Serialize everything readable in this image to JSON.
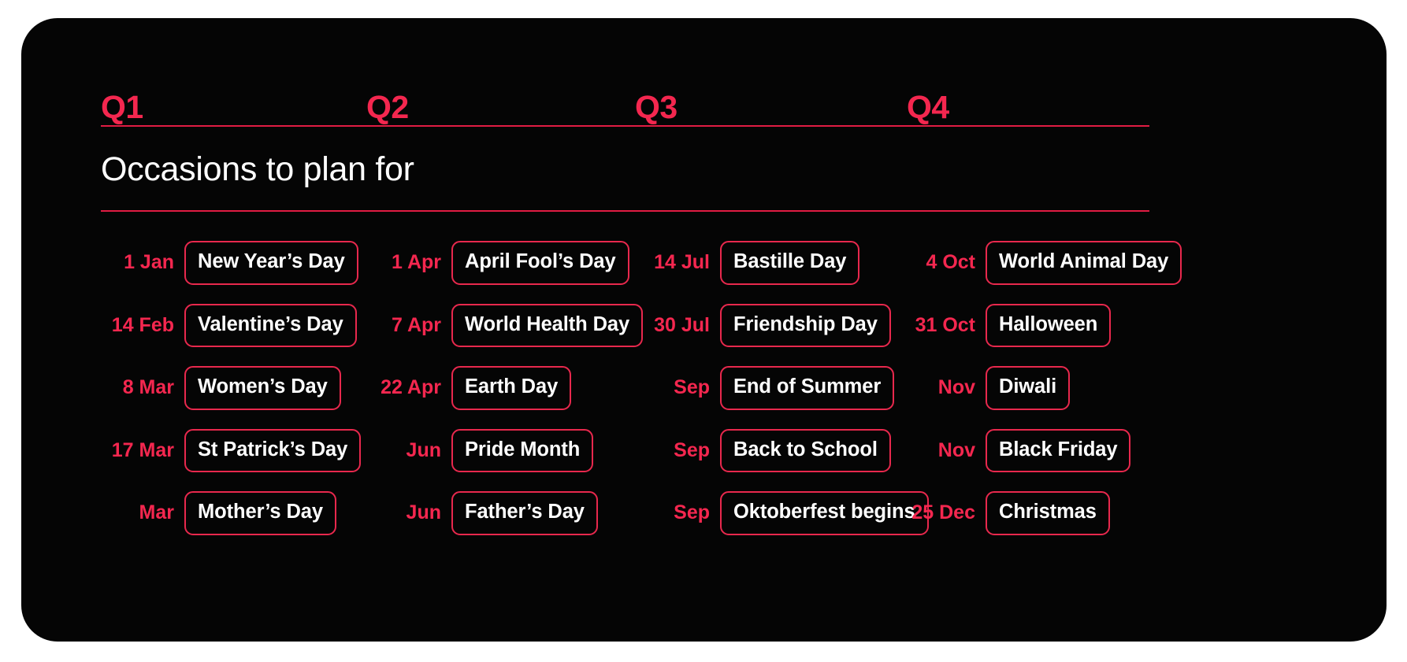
{
  "colors": {
    "background": "#ffffff",
    "card": "#050505",
    "accent": "#f4274f",
    "rule": "#e01c43",
    "pill_border": "#e8284d",
    "text": "#ffffff"
  },
  "header": {
    "quarters": [
      "Q1",
      "Q2",
      "Q3",
      "Q4"
    ]
  },
  "section": {
    "title": "Occasions to plan for"
  },
  "columns": [
    {
      "quarter": "Q1",
      "items": [
        {
          "date": "1 Jan",
          "occasion": "New Year’s Day"
        },
        {
          "date": "14 Feb",
          "occasion": "Valentine’s Day"
        },
        {
          "date": "8 Mar",
          "occasion": "Women’s Day"
        },
        {
          "date": "17 Mar",
          "occasion": "St Patrick’s Day"
        },
        {
          "date": "Mar",
          "occasion": "Mother’s Day"
        }
      ]
    },
    {
      "quarter": "Q2",
      "items": [
        {
          "date": "1 Apr",
          "occasion": "April Fool’s Day"
        },
        {
          "date": "7 Apr",
          "occasion": "World Health Day"
        },
        {
          "date": "22 Apr",
          "occasion": "Earth Day"
        },
        {
          "date": "Jun",
          "occasion": "Pride Month"
        },
        {
          "date": "Jun",
          "occasion": "Father’s Day"
        }
      ]
    },
    {
      "quarter": "Q3",
      "items": [
        {
          "date": "14 Jul",
          "occasion": "Bastille Day"
        },
        {
          "date": "30 Jul",
          "occasion": "Friendship Day"
        },
        {
          "date": "Sep",
          "occasion": "End of Summer"
        },
        {
          "date": "Sep",
          "occasion": "Back to School"
        },
        {
          "date": "Sep",
          "occasion": "Oktoberfest begins"
        }
      ]
    },
    {
      "quarter": "Q4",
      "items": [
        {
          "date": "4 Oct",
          "occasion": "World Animal Day"
        },
        {
          "date": "31 Oct",
          "occasion": "Halloween"
        },
        {
          "date": "Nov",
          "occasion": "Diwali"
        },
        {
          "date": "Nov",
          "occasion": "Black Friday"
        },
        {
          "date": "25 Dec",
          "occasion": "Christmas"
        }
      ]
    }
  ]
}
